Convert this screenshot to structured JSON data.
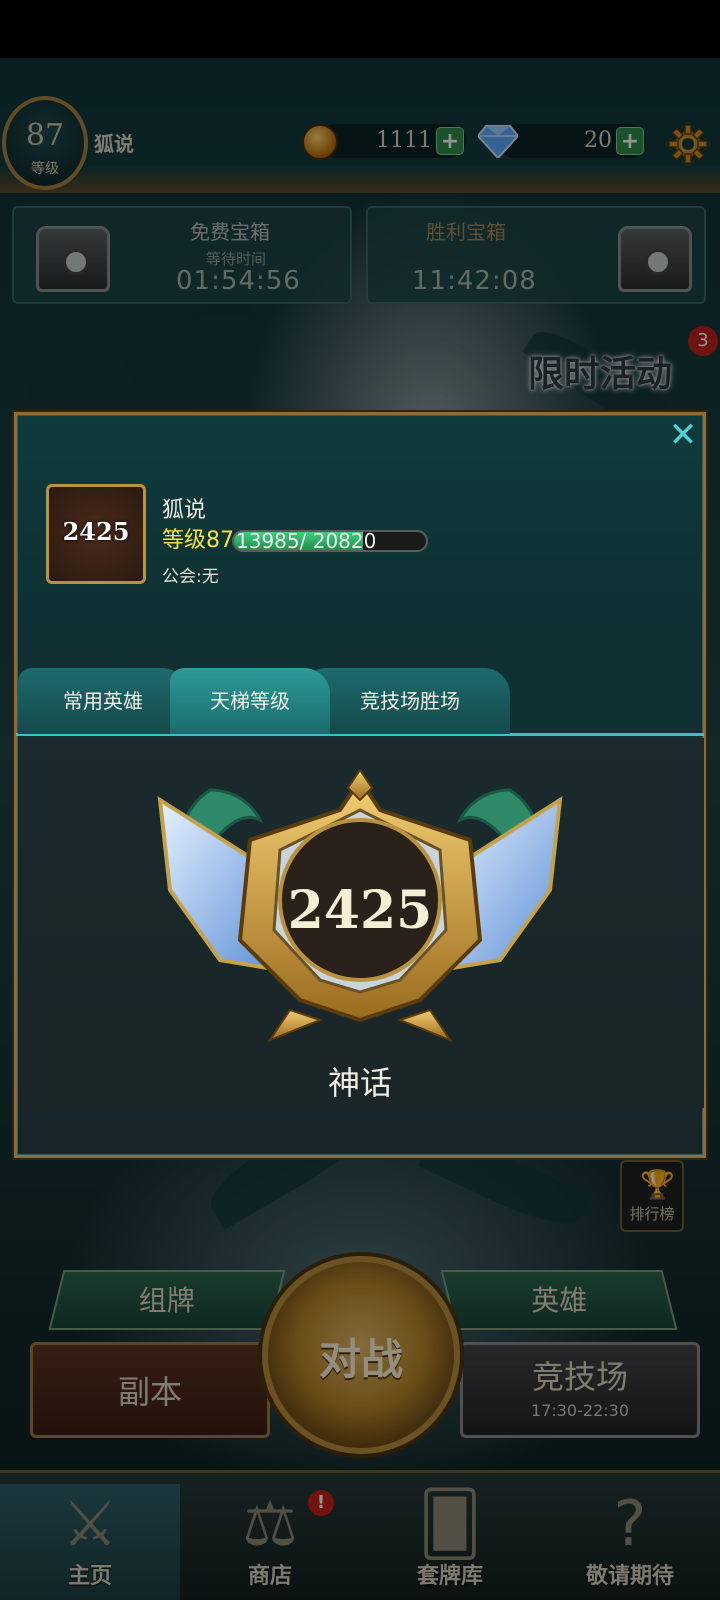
{
  "player": {
    "level": "87",
    "level_label": "等级",
    "name": "狐说"
  },
  "currency": {
    "gold": "1111",
    "gems": "20",
    "plus": "+"
  },
  "chests": {
    "free": {
      "title": "免费宝箱",
      "subtitle": "等待时间",
      "time": "01:54:56"
    },
    "victory": {
      "title": "胜利宝箱",
      "time": "11:42:08"
    }
  },
  "event": {
    "label": "限时活动",
    "count": "3"
  },
  "dialog": {
    "close": "✕",
    "rank_score": "2425",
    "name": "狐说",
    "level_text": "等级87",
    "xp_text": "13985/ 20820",
    "xp_current": 13985,
    "xp_max": 20820,
    "guild": "公会:无",
    "tabs": [
      "常用英雄",
      "天梯等级",
      "竞技场胜场"
    ],
    "active_tab": 1,
    "emblem_score": "2425",
    "tier": "神话"
  },
  "leaderboard": {
    "label": "排行榜"
  },
  "menu": {
    "deck": "组牌",
    "heroes": "英雄",
    "dungeon": "副本",
    "battle": "对战",
    "arena": "竞技场",
    "arena_time": "17:30-22:30"
  },
  "nav": {
    "items": [
      {
        "label": "主页",
        "icon": "crossed-swords-icon"
      },
      {
        "label": "商店",
        "icon": "scales-icon"
      },
      {
        "label": "套牌库",
        "icon": "cards-icon"
      },
      {
        "label": "敬请期待",
        "icon": "question-icon"
      }
    ],
    "active": 0,
    "shop_alert": "!"
  },
  "colors": {
    "accent_teal": "#3fbfc0",
    "gold_border": "#8a6e3c",
    "level_yellow": "#f0e24a",
    "xp_green": "#3fcf7e",
    "alert_red": "#c52118"
  }
}
